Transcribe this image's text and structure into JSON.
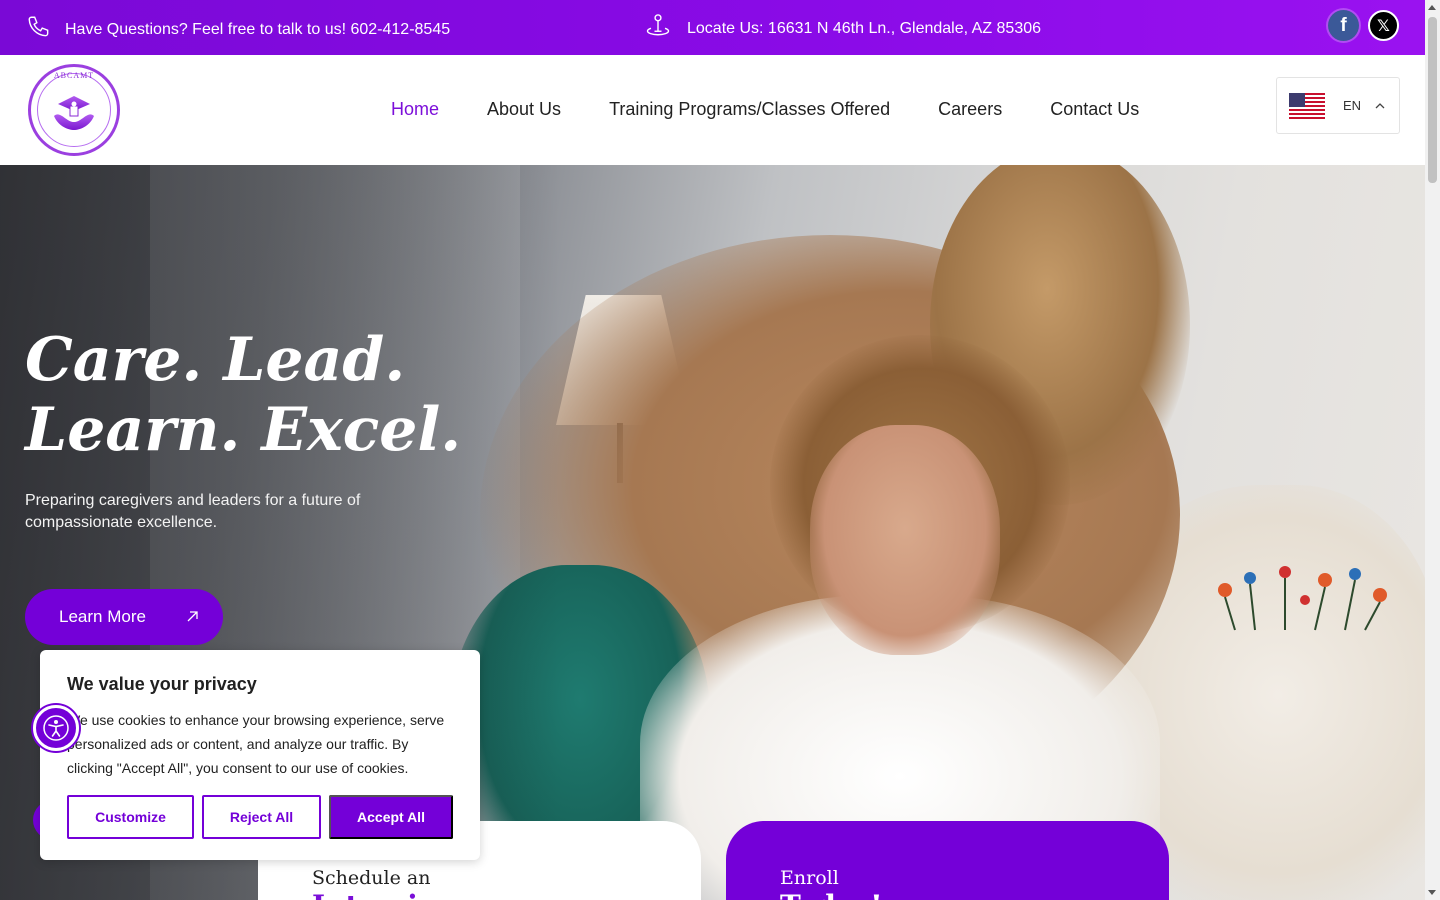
{
  "topbar": {
    "phone_text": "Have Questions? Feel free to talk to us! 602-412-8545",
    "locate_text": "Locate Us: 16631 N 46th Ln., Glendale, AZ 85306",
    "social": [
      {
        "icon": "facebook-icon",
        "glyph": "f"
      },
      {
        "icon": "x-twitter-icon",
        "glyph": "𝕏"
      }
    ]
  },
  "header": {
    "logo_text": "ABCAMT",
    "nav": [
      {
        "label": "Home",
        "active": true
      },
      {
        "label": "About Us"
      },
      {
        "label": "Training Programs/Classes Offered"
      },
      {
        "label": "Careers"
      },
      {
        "label": "Contact Us"
      }
    ],
    "language": {
      "code": "EN",
      "flag": "us-flag-icon"
    }
  },
  "hero": {
    "headline_line1": "Care. Lead.",
    "headline_line2": "Learn. Excel.",
    "subtext": "Preparing caregivers and leaders for a future of compassionate excellence.",
    "cta_label": "Learn More"
  },
  "cards": {
    "left_label": "Schedule an",
    "left_big": "Interview",
    "right_label": "Enroll",
    "right_big": "Today!"
  },
  "cookie": {
    "title": "We value your privacy",
    "message": "We use cookies to enhance your browsing experience, serve personalized ads or content, and analyze our traffic. By clicking \"Accept All\", you consent to our use of cookies.",
    "customize_label": "Customize",
    "reject_label": "Reject All",
    "accept_label": "Accept All"
  },
  "colors": {
    "brand_purple": "#7400d8",
    "topbar_purple": "#8b0be8"
  }
}
